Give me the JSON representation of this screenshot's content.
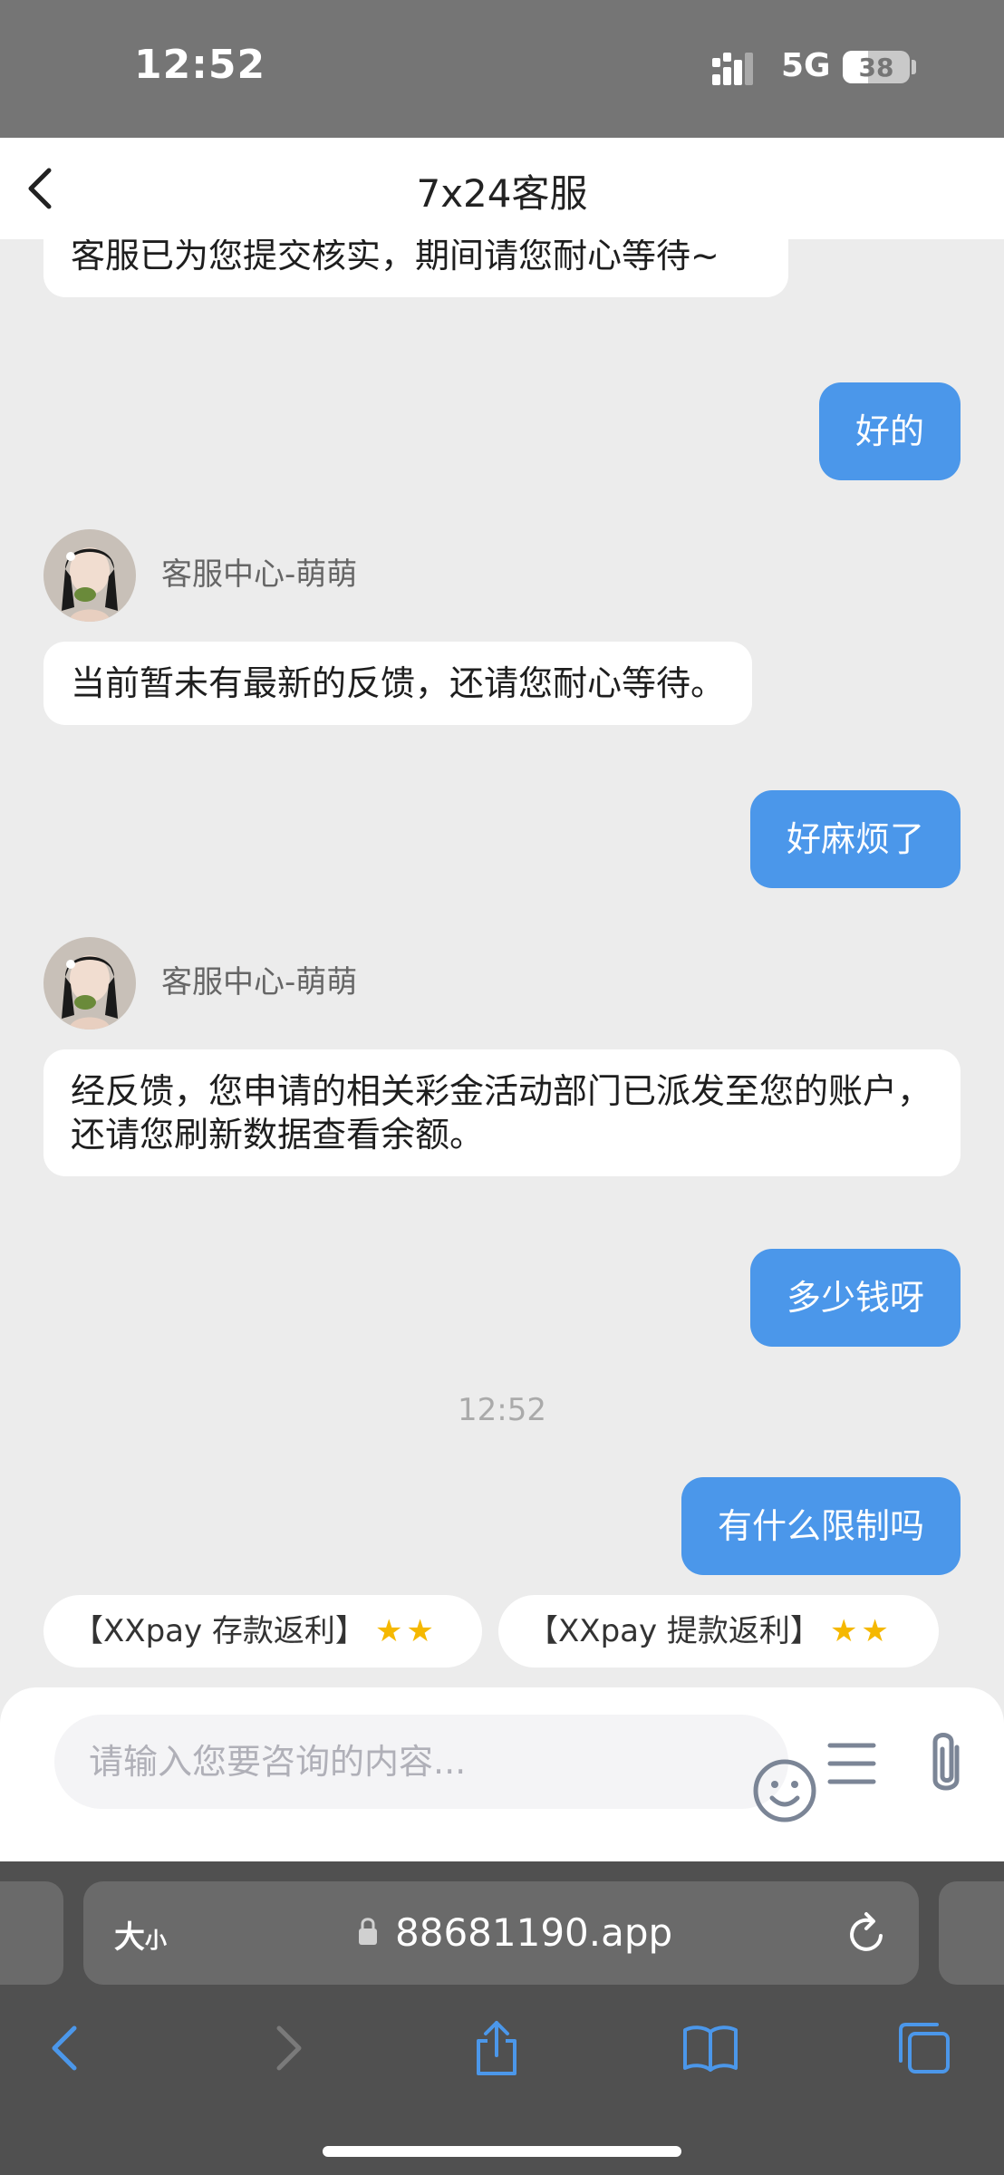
{
  "status_bar": {
    "time": "12:52",
    "network": "5G",
    "battery_percent": "38"
  },
  "header": {
    "title": "7x24客服"
  },
  "messages": [
    {
      "side": "in",
      "text": "客服已为您提交核实，期间请您耐心等待~"
    },
    {
      "side": "out",
      "text": "好的"
    },
    {
      "side": "in",
      "sender": "客服中心-萌萌",
      "text": "当前暂未有最新的反馈，还请您耐心等待。"
    },
    {
      "side": "out",
      "text": "好麻烦了"
    },
    {
      "side": "in",
      "sender": "客服中心-萌萌",
      "text": "经反馈，您申请的相关彩金活动部门已派发至您的账户，还请您刷新数据查看余额。"
    },
    {
      "side": "out",
      "text": "多少钱呀"
    },
    {
      "type": "timestamp",
      "text": "12:52"
    },
    {
      "side": "out",
      "text": "有什么限制吗"
    }
  ],
  "quick_replies": [
    {
      "label": "【XXpay 存款返利】"
    },
    {
      "label": "【XXpay 提款返利】"
    }
  ],
  "input": {
    "placeholder": "请输入您要咨询的内容..."
  },
  "browser": {
    "text_size_label": "大",
    "text_size_small": "小",
    "url": "88681190.app"
  },
  "colors": {
    "accent": "#4b97ea",
    "browser_chrome": "#505050",
    "status_bar": "#757575"
  }
}
